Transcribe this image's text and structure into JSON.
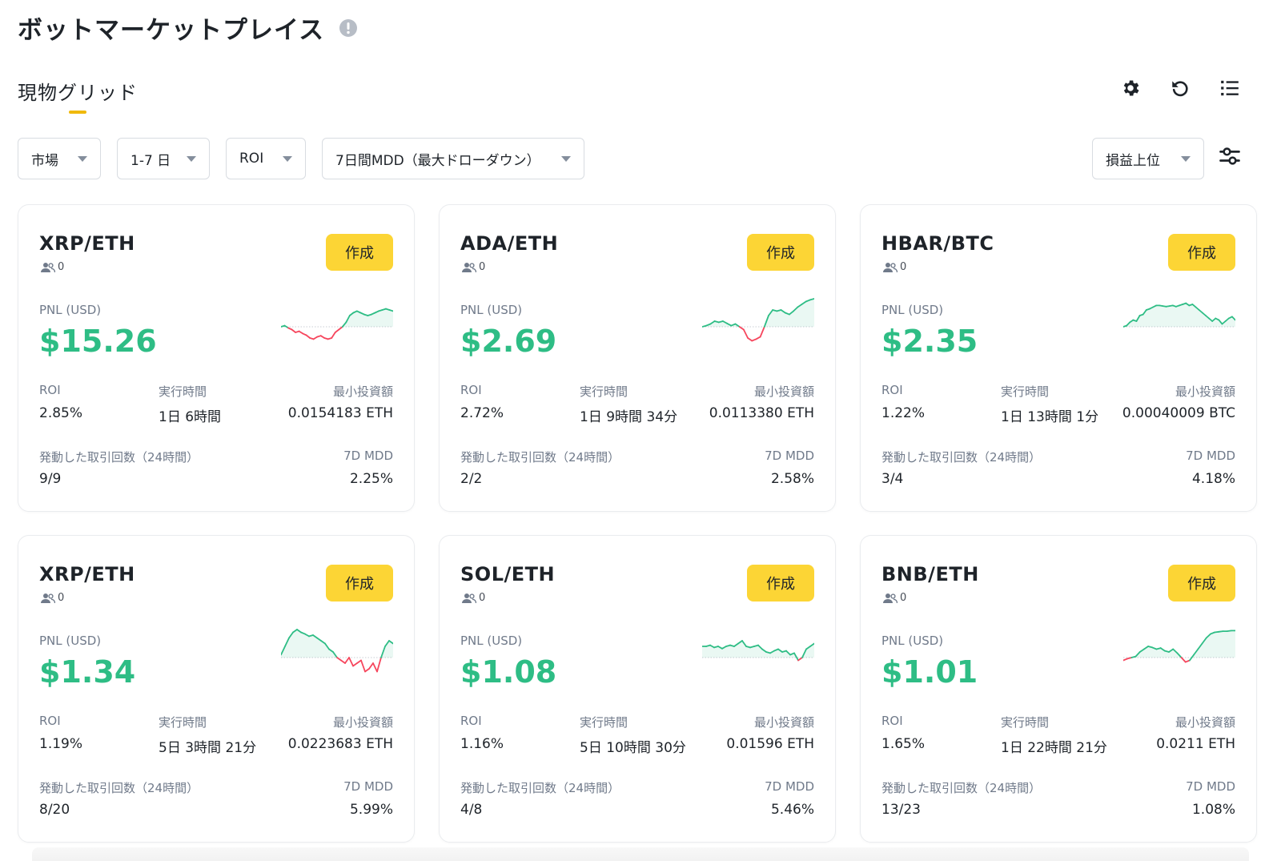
{
  "header": {
    "title": "ボットマーケットプレイス",
    "info_icon": "info-circle-icon"
  },
  "tab": {
    "label": "現物グリッド"
  },
  "toolbar": {
    "icons": [
      "gear-icon",
      "refresh-icon",
      "list-icon"
    ]
  },
  "filters": {
    "market": "市場",
    "period": "1-7 日",
    "metric": "ROI",
    "mdd": "7日間MDD（最大ドローダウン）",
    "sort": "損益上位"
  },
  "labels": {
    "create": "作成",
    "pnl": "PNL (USD)",
    "roi": "ROI",
    "runtime": "実行時間",
    "min_invest": "最小投資額",
    "trades": "発動した取引回数（24時間）",
    "mdd": "7D MDD"
  },
  "colors": {
    "accent": "#fcd535",
    "up": "#2ebd85",
    "down": "#f6465d"
  },
  "cards": [
    {
      "pair": "XRP/ETH",
      "users": "0",
      "pnl": "$15.26",
      "roi": "2.85%",
      "runtime": "1日 6時間",
      "min_invest": "0.0154183 ETH",
      "trades": "9/9",
      "mdd": "2.25%",
      "spark": [
        0.5,
        0.48,
        0.52,
        0.55,
        0.6,
        0.58,
        0.62,
        0.65,
        0.7,
        0.72,
        0.68,
        0.66,
        0.7,
        0.72,
        0.7,
        0.6,
        0.55,
        0.5,
        0.42,
        0.3,
        0.25,
        0.22,
        0.25,
        0.28,
        0.3,
        0.28,
        0.25,
        0.22,
        0.2,
        0.18,
        0.2,
        0.22
      ]
    },
    {
      "pair": "ADA/ETH",
      "users": "0",
      "pnl": "$2.69",
      "roi": "2.72%",
      "runtime": "1日 9時間 34分",
      "min_invest": "0.0113380 ETH",
      "trades": "2/2",
      "mdd": "2.58%",
      "spark": [
        0.5,
        0.48,
        0.45,
        0.4,
        0.42,
        0.4,
        0.44,
        0.48,
        0.45,
        0.5,
        0.55,
        0.7,
        0.75,
        0.72,
        0.68,
        0.5,
        0.3,
        0.2,
        0.22,
        0.2,
        0.25,
        0.28,
        0.22,
        0.15,
        0.1,
        0.05,
        0.02,
        0.0
      ]
    },
    {
      "pair": "HBAR/BTC",
      "users": "0",
      "pnl": "$2.35",
      "roi": "1.22%",
      "runtime": "1日 13時間 1分",
      "min_invest": "0.00040009 BTC",
      "trades": "3/4",
      "mdd": "4.18%",
      "spark": [
        0.5,
        0.48,
        0.42,
        0.38,
        0.4,
        0.3,
        0.28,
        0.2,
        0.18,
        0.15,
        0.12,
        0.12,
        0.13,
        0.14,
        0.13,
        0.12,
        0.14,
        0.12,
        0.1,
        0.08,
        0.12,
        0.1,
        0.15,
        0.2,
        0.25,
        0.3,
        0.35,
        0.4,
        0.35,
        0.38,
        0.45,
        0.4,
        0.35,
        0.32,
        0.38
      ]
    },
    {
      "pair": "XRP/ETH",
      "users": "0",
      "pnl": "$1.34",
      "roi": "1.19%",
      "runtime": "5日 3時間 21分",
      "min_invest": "0.0223683 ETH",
      "trades": "8/20",
      "mdd": "5.99%",
      "spark": [
        0.45,
        0.3,
        0.15,
        0.05,
        0.0,
        0.05,
        0.08,
        0.12,
        0.1,
        0.15,
        0.2,
        0.25,
        0.35,
        0.4,
        0.5,
        0.55,
        0.6,
        0.5,
        0.65,
        0.6,
        0.55,
        0.75,
        0.7,
        0.6,
        0.75,
        0.5,
        0.3,
        0.2,
        0.25
      ]
    },
    {
      "pair": "SOL/ETH",
      "users": "0",
      "pnl": "$1.08",
      "roi": "1.16%",
      "runtime": "5日 10時間 30分",
      "min_invest": "0.01596 ETH",
      "trades": "4/8",
      "mdd": "5.46%",
      "spark": [
        0.3,
        0.3,
        0.28,
        0.32,
        0.3,
        0.34,
        0.3,
        0.28,
        0.3,
        0.25,
        0.2,
        0.3,
        0.32,
        0.3,
        0.28,
        0.35,
        0.4,
        0.42,
        0.38,
        0.35,
        0.4,
        0.38,
        0.45,
        0.42,
        0.55,
        0.5,
        0.35,
        0.3,
        0.25
      ]
    },
    {
      "pair": "BNB/ETH",
      "users": "0",
      "pnl": "$1.01",
      "roi": "1.65%",
      "runtime": "1日 22時間 21分",
      "min_invest": "0.0211 ETH",
      "trades": "13/23",
      "mdd": "1.08%",
      "spark": [
        0.55,
        0.52,
        0.5,
        0.48,
        0.4,
        0.35,
        0.3,
        0.32,
        0.35,
        0.33,
        0.38,
        0.4,
        0.35,
        0.42,
        0.5,
        0.58,
        0.55,
        0.45,
        0.35,
        0.25,
        0.15,
        0.08,
        0.05,
        0.04,
        0.03,
        0.03,
        0.02,
        0.02
      ]
    }
  ]
}
